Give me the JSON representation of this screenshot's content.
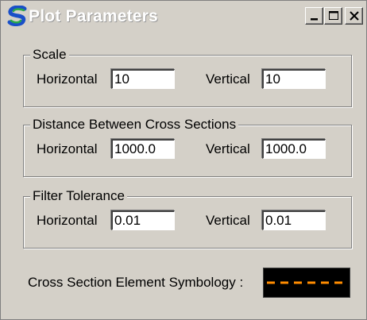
{
  "window": {
    "title": "Plot Parameters",
    "app_icon": "s-logo-icon",
    "title_buttons": [
      "minimize-icon",
      "maximize-icon",
      "close-icon"
    ]
  },
  "scale": {
    "group_label": "Scale",
    "horizontal_label": "Horizontal",
    "horizontal_value": "10",
    "vertical_label": "Vertical",
    "vertical_value": "10"
  },
  "distance": {
    "group_label": "Distance Between Cross Sections",
    "horizontal_label": "Horizontal",
    "horizontal_value": "1000.0",
    "vertical_label": "Vertical",
    "vertical_value": "1000.0"
  },
  "filter": {
    "group_label": "Filter Tolerance",
    "horizontal_label": "Horizontal",
    "horizontal_value": "0.01",
    "vertical_label": "Vertical",
    "vertical_value": "0.01"
  },
  "symbology": {
    "label": "Cross Section Element Symbology :",
    "line_color": "#ff8c00",
    "background_color": "#000000",
    "line_style": "dashed"
  },
  "colors": {
    "dialog_background": "#d4d0c8",
    "title_text": "#ffffff",
    "icon_blue": "#1a4fc8",
    "icon_green": "#2aa84a"
  }
}
